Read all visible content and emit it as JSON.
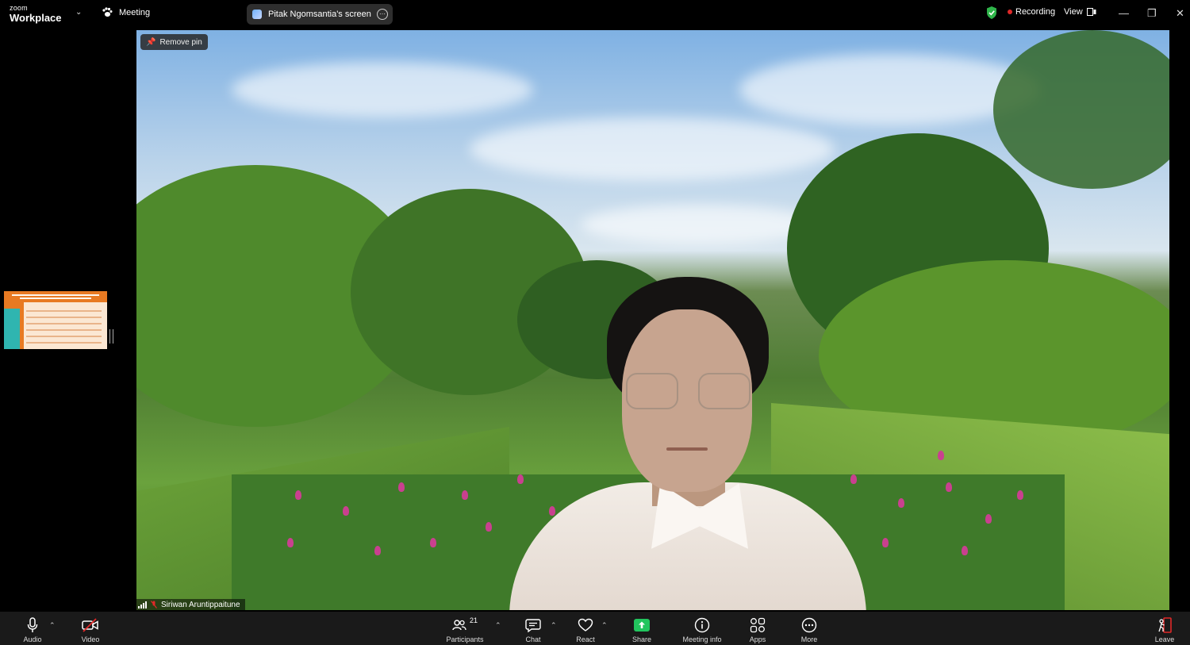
{
  "app": {
    "logo_small": "zoom",
    "logo_big": "Workplace"
  },
  "topbar": {
    "meeting_label": "Meeting",
    "share_label": "Pitak Ngomsantia's screen",
    "recording_label": "Recording",
    "view_label": "View"
  },
  "video": {
    "remove_pin_label": "Remove pin",
    "participant_name": "Siriwan Aruntippaitune"
  },
  "toolbar": {
    "audio": "Audio",
    "video": "Video",
    "participants": "Participants",
    "participants_count": "21",
    "chat": "Chat",
    "react": "React",
    "share": "Share",
    "meeting_info": "Meeting info",
    "apps": "Apps",
    "more": "More",
    "leave": "Leave"
  },
  "colors": {
    "share_green": "#22c55e",
    "recording_red": "#e02828",
    "leave_red": "#e02828"
  }
}
